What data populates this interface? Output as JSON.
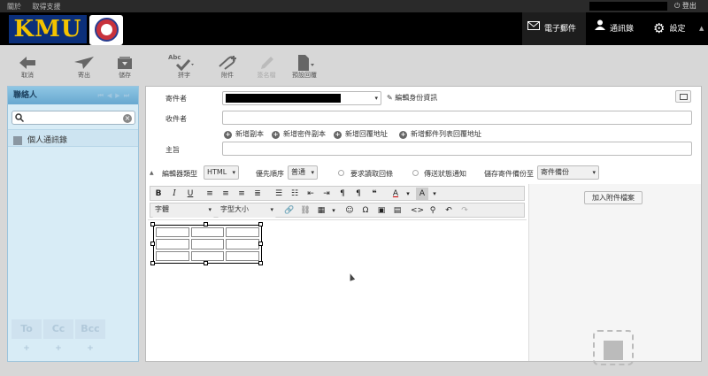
{
  "topbar": {
    "help": "關於",
    "support": "取得支援",
    "logout": "登出"
  },
  "brand": {
    "logo_text": "KMU"
  },
  "nav": {
    "mail": "電子郵件",
    "contacts": "通訊錄",
    "settings": "設定"
  },
  "toolbar": {
    "cancel": "取消",
    "send": "寄出",
    "save": "儲存",
    "spell": "拼字",
    "attach": "附件",
    "signature": "簽名檔",
    "preset": "預設回覆",
    "spell_abbr": "Abc"
  },
  "contacts_pane": {
    "title": "聯絡人",
    "item": "個人通訊錄",
    "to": "To",
    "cc": "Cc",
    "bcc": "Bcc"
  },
  "compose": {
    "from_label": "寄件者",
    "edit_identity": "編輯身份資訊",
    "to_label": "收件者",
    "subject_label": "主旨",
    "add_cc": "新增副本",
    "add_bcc": "新增密件副本",
    "add_reply_to": "新增回覆地址",
    "add_followup_to": "新增郵件列表回覆地址",
    "editor_type_label": "編輯器類型",
    "editor_type": "HTML",
    "priority_label": "優先順序",
    "priority": "普通",
    "mdn": "要求讀取回條",
    "dsn": "傳送狀態通知",
    "store_label": "儲存寄件備份至",
    "store_value": "寄件備份",
    "font_family": "字體",
    "font_size": "字型大小",
    "attach_button": "加入附件檔案"
  }
}
